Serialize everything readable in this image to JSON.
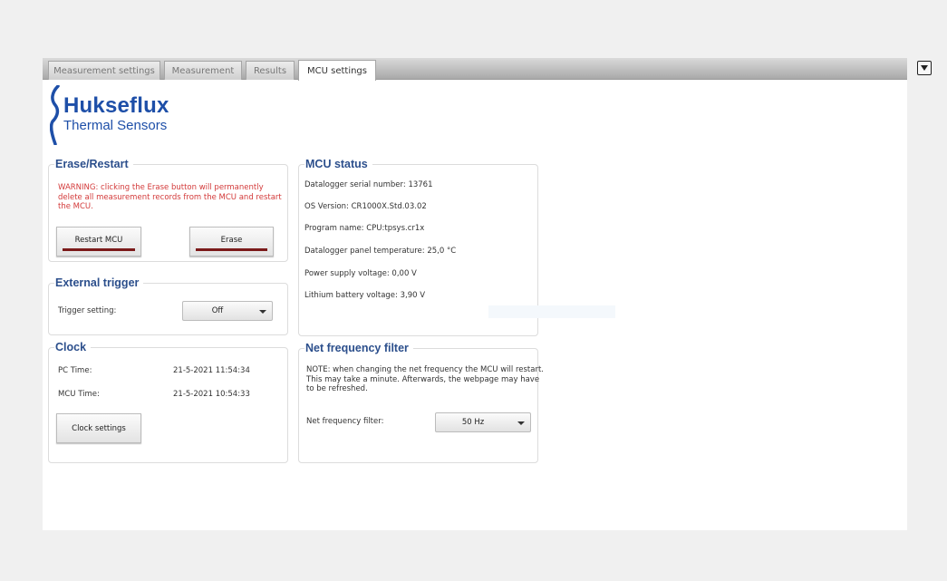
{
  "tabs": [
    {
      "label": "Measurement settings"
    },
    {
      "label": "Measurement"
    },
    {
      "label": "Results"
    },
    {
      "label": "MCU settings"
    }
  ],
  "logo": {
    "brand": "Hukseflux",
    "subtitle": "Thermal Sensors"
  },
  "erase_restart": {
    "title": "Erase/Restart",
    "warning": "WARNING: clicking the Erase button will permanently delete all measurement records from the MCU and restart the MCU.",
    "restart_label": "Restart MCU",
    "erase_label": "Erase"
  },
  "external_trigger": {
    "title": "External trigger",
    "setting_label": "Trigger setting:",
    "setting_value": "Off"
  },
  "clock": {
    "title": "Clock",
    "pc_label": "PC Time:",
    "pc_value": "21-5-2021 11:54:34",
    "mcu_label": "MCU Time:",
    "mcu_value": "21-5-2021 10:54:33",
    "settings_label": "Clock settings"
  },
  "mcu_status": {
    "title": "MCU status",
    "lines": [
      "Datalogger serial number: 13761",
      "OS Version: CR1000X.Std.03.02",
      "Program name: CPU:tpsys.cr1x",
      "Datalogger panel temperature: 25,0 °C",
      "Power supply voltage: 0,00 V",
      "Lithium battery voltage: 3,90 V"
    ]
  },
  "net_filter": {
    "title": "Net frequency filter",
    "note": "NOTE: when changing the net frequency the MCU will restart. This may take a minute. Afterwards, the webpage may have to be refreshed.",
    "label": "Net frequency filter:",
    "value": "50 Hz"
  },
  "colors": {
    "accent": "#2c4f8c",
    "brand": "#1e4fa8",
    "warning": "#d33a3a",
    "button_bar": "#7b1a1a"
  }
}
